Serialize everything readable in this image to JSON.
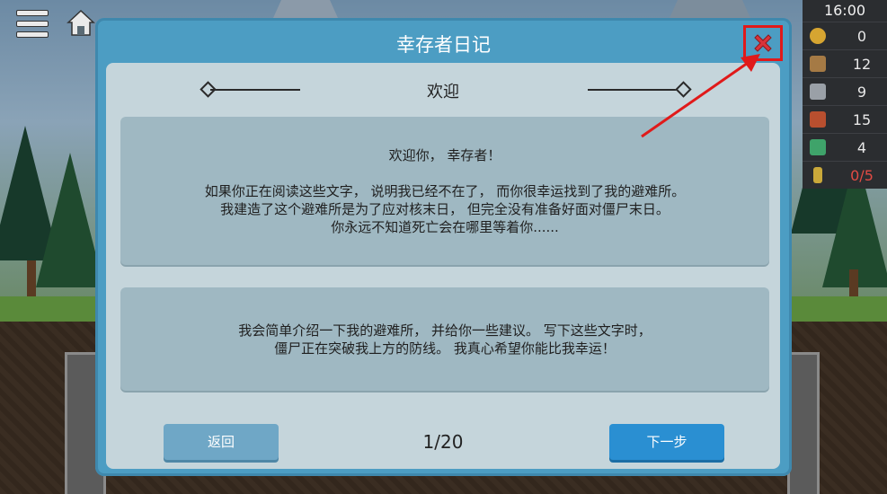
{
  "hud": {
    "menu_icon": "hamburger-menu-icon",
    "home_icon": "home-icon"
  },
  "resources": {
    "time": "16:00",
    "items": [
      {
        "icon": "coin-icon",
        "value": "0",
        "color": "#d6a531",
        "highlight": false
      },
      {
        "icon": "wood-plank-icon",
        "value": "12",
        "color": "#a57a45",
        "highlight": false
      },
      {
        "icon": "metal-bar-icon",
        "value": "9",
        "color": "#9aa0a7",
        "highlight": false
      },
      {
        "icon": "book-icon",
        "value": "15",
        "color": "#b84f2f",
        "highlight": false
      },
      {
        "icon": "circuit-board-icon",
        "value": "4",
        "color": "#3fa36a",
        "highlight": false
      },
      {
        "icon": "battery-icon",
        "value": "0/5",
        "color": "#c9a83a",
        "highlight": true
      }
    ]
  },
  "dialog": {
    "title": "幸存者日记",
    "close_icon": "close-icon",
    "section_title": "欢迎",
    "card1": {
      "greeting": "欢迎你， 幸存者！",
      "lines": [
        "如果你正在阅读这些文字， 说明我已经不在了， 而你很幸运找到了我的避难所。",
        "我建造了这个避难所是为了应对核末日， 但完全没有准备好面对僵尸末日。",
        "你永远不知道死亡会在哪里等着你......"
      ]
    },
    "card2": {
      "lines": [
        "我会简单介绍一下我的避难所， 并给你一些建议。 写下这些文字时，",
        "僵尸正在突破我上方的防线。 我真心希望你能比我幸运！"
      ]
    },
    "back_label": "返回",
    "page_indicator": "1/20",
    "next_label": "下一步"
  },
  "colors": {
    "dialog_frame": "#4c9dc3",
    "dialog_inner": "#c5d5db",
    "card": "#9fb8c2",
    "next_button": "#2a8fd2",
    "back_button": "#6fa7c6",
    "annotation": "#e01a1a"
  }
}
